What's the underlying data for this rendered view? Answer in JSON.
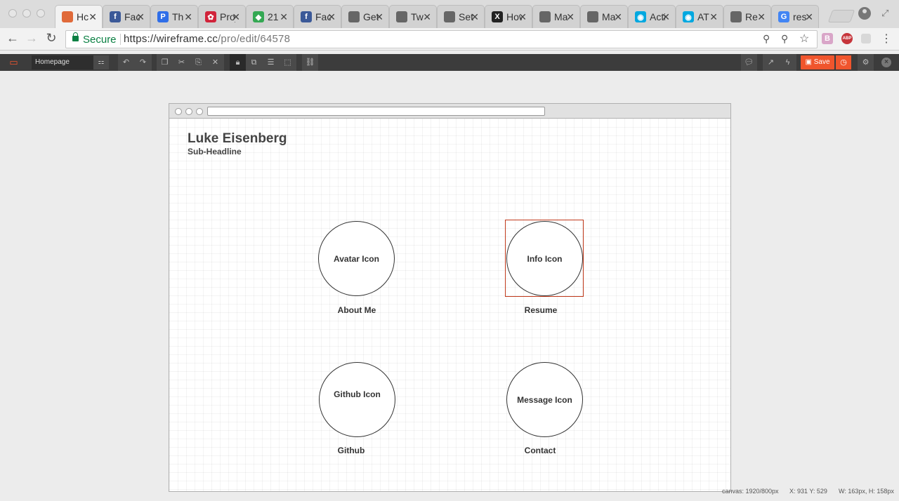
{
  "browser": {
    "tabs": [
      {
        "title": "Hc",
        "icon": "wireframe-favicon",
        "color": "#e06a3a",
        "glyph": "",
        "active": true
      },
      {
        "title": "Fac",
        "icon": "facebook-favicon",
        "color": "#3b5998",
        "glyph": "f"
      },
      {
        "title": "Th",
        "icon": "picsart-favicon",
        "color": "#2f6ee8",
        "glyph": "P"
      },
      {
        "title": "Proje",
        "icon": "project-favicon",
        "color": "#d1233a",
        "glyph": "✿"
      },
      {
        "title": "21",
        "icon": "maps-favicon",
        "color": "#34a853",
        "glyph": "◆"
      },
      {
        "title": "Fac",
        "icon": "facebook-favicon",
        "color": "#3b5998",
        "glyph": "f"
      },
      {
        "title": "Get a",
        "icon": "apple-favicon",
        "color": "#666666",
        "glyph": ""
      },
      {
        "title": "Tw",
        "icon": "apple-favicon",
        "color": "#666666",
        "glyph": ""
      },
      {
        "title": "Set",
        "icon": "apple-favicon",
        "color": "#666666",
        "glyph": ""
      },
      {
        "title": "How",
        "icon": "x-favicon",
        "color": "#222222",
        "glyph": "X"
      },
      {
        "title": "Ma",
        "icon": "apple-favicon",
        "color": "#666666",
        "glyph": ""
      },
      {
        "title": "Ma",
        "icon": "apple-favicon",
        "color": "#666666",
        "glyph": ""
      },
      {
        "title": "Activ",
        "icon": "att-favicon",
        "color": "#00a8e0",
        "glyph": "◉"
      },
      {
        "title": "AT",
        "icon": "att-favicon",
        "color": "#00a8e0",
        "glyph": "◉"
      },
      {
        "title": "Re",
        "icon": "apple-favicon",
        "color": "#666666",
        "glyph": ""
      },
      {
        "title": "res",
        "icon": "google-favicon",
        "color": "#4285f4",
        "glyph": "G"
      }
    ],
    "secure_label": "Secure",
    "url_scheme": "https://",
    "url_host": "wireframe.cc",
    "url_path": "/pro/edit/64578",
    "ext_b": "B",
    "ext_abp": "ABP"
  },
  "app_toolbar": {
    "page_name": "Homepage",
    "save_label": "Save"
  },
  "wireframe": {
    "headline": "Luke Eisenberg",
    "subheadline": "Sub-Headline",
    "items": [
      {
        "circle": "Avatar Icon",
        "caption": "About Me"
      },
      {
        "circle": "Info Icon",
        "caption": "Resume"
      },
      {
        "circle": "Github Icon",
        "caption": "Github"
      },
      {
        "circle": "Message Icon",
        "caption": "Contact"
      }
    ]
  },
  "status": {
    "canvas": "canvas: 1920/800px",
    "coords": "X: 931 Y: 529",
    "size": "W: 163px, H: 158px"
  },
  "colors": {
    "accent": "#f0552d",
    "selection": "#c0391b",
    "secure": "#0b8043"
  }
}
